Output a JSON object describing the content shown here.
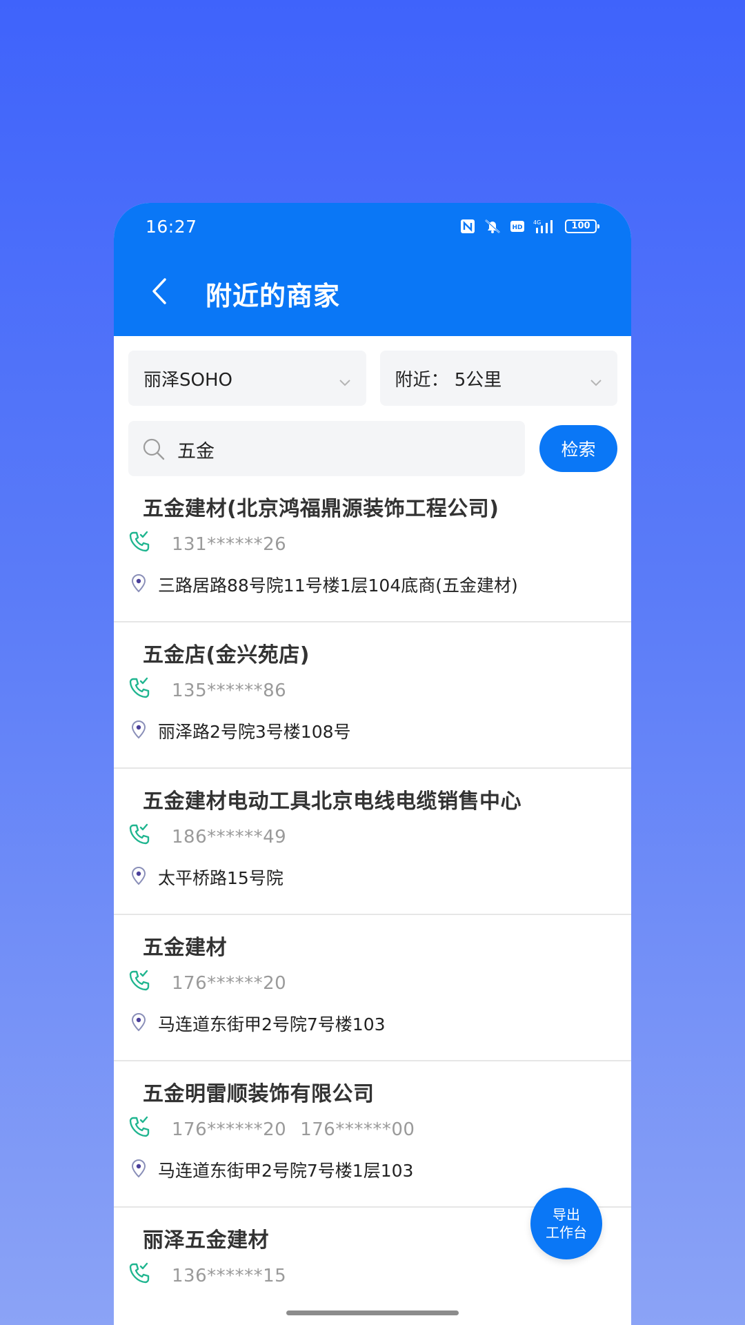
{
  "status_bar": {
    "time": "16:27",
    "battery": "100",
    "icons": [
      "nfc-icon",
      "mute-icon",
      "hd-icon",
      "signal-4g-icon",
      "battery-icon"
    ]
  },
  "header": {
    "title": "附近的商家",
    "back_icon": "chevron-left-icon"
  },
  "filters": {
    "location": "丽泽SOHO",
    "distance": "附近： 5公里"
  },
  "search": {
    "value": "五金",
    "button_label": "检索"
  },
  "merchants": [
    {
      "name": "五金建材(北京鸿福鼎源装饰工程公司)",
      "phones": [
        "131******26"
      ],
      "address": "三路居路88号院11号楼1层104底商(五金建材)"
    },
    {
      "name": "五金店(金兴苑店)",
      "phones": [
        "135******86"
      ],
      "address": "丽泽路2号院3号楼108号"
    },
    {
      "name": "五金建材电动工具北京电线电缆销售中心",
      "phones": [
        "186******49"
      ],
      "address": "太平桥路15号院"
    },
    {
      "name": "五金建材",
      "phones": [
        "176******20"
      ],
      "address": "马连道东街甲2号院7号楼103"
    },
    {
      "name": "五金明雷顺装饰有限公司",
      "phones": [
        "176******20",
        "176******00"
      ],
      "address": "马连道东街甲2号院7号楼1层103"
    },
    {
      "name": "丽泽五金建材",
      "phones": [
        "136******15"
      ],
      "address": ""
    }
  ],
  "fab": {
    "line1": "导出",
    "line2": "工作台"
  },
  "colors": {
    "primary": "#0a77f6",
    "phone_icon": "#1fb58f",
    "pin_icon": "#8a8fb8",
    "background_top": "#3f63fb",
    "background_bottom": "#8ba3f6"
  }
}
